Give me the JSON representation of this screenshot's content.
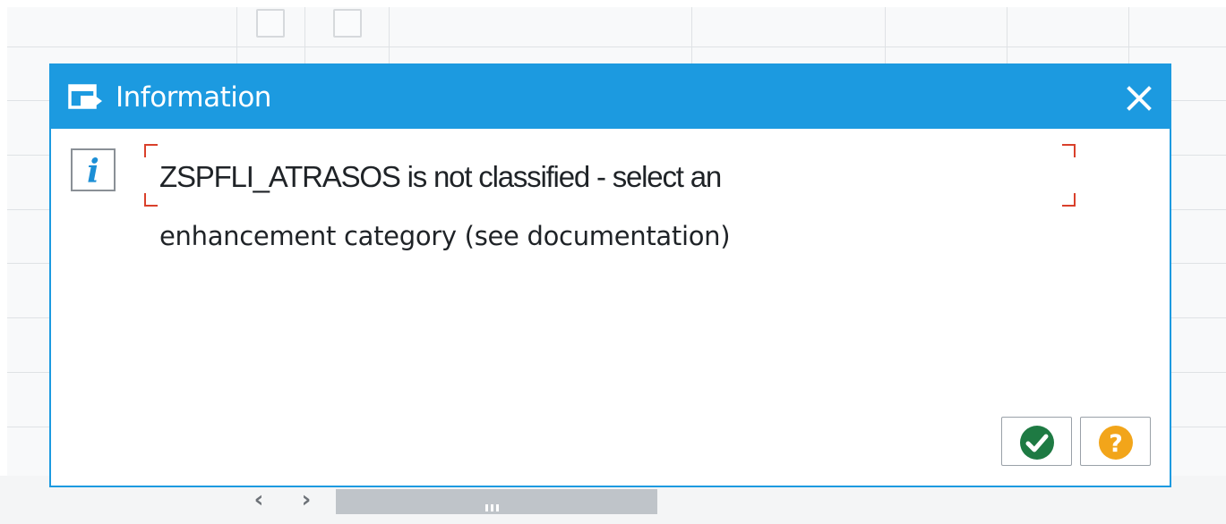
{
  "dialog": {
    "title": "Information",
    "message_line1": "ZSPFLI_ATRASOS is not classified - select an",
    "message_line2": "enhancement category (see documentation)",
    "icons": {
      "title_icon": "message-window-icon",
      "message_type_icon": "info-icon",
      "close_icon": "close-icon",
      "confirm_icon": "checkmark-icon",
      "help_icon": "help-question-icon"
    },
    "colors": {
      "header": "#1c9ae0",
      "confirm": "#1e7a43",
      "help": "#f2a51a",
      "focus_bracket": "#d9402b"
    }
  }
}
